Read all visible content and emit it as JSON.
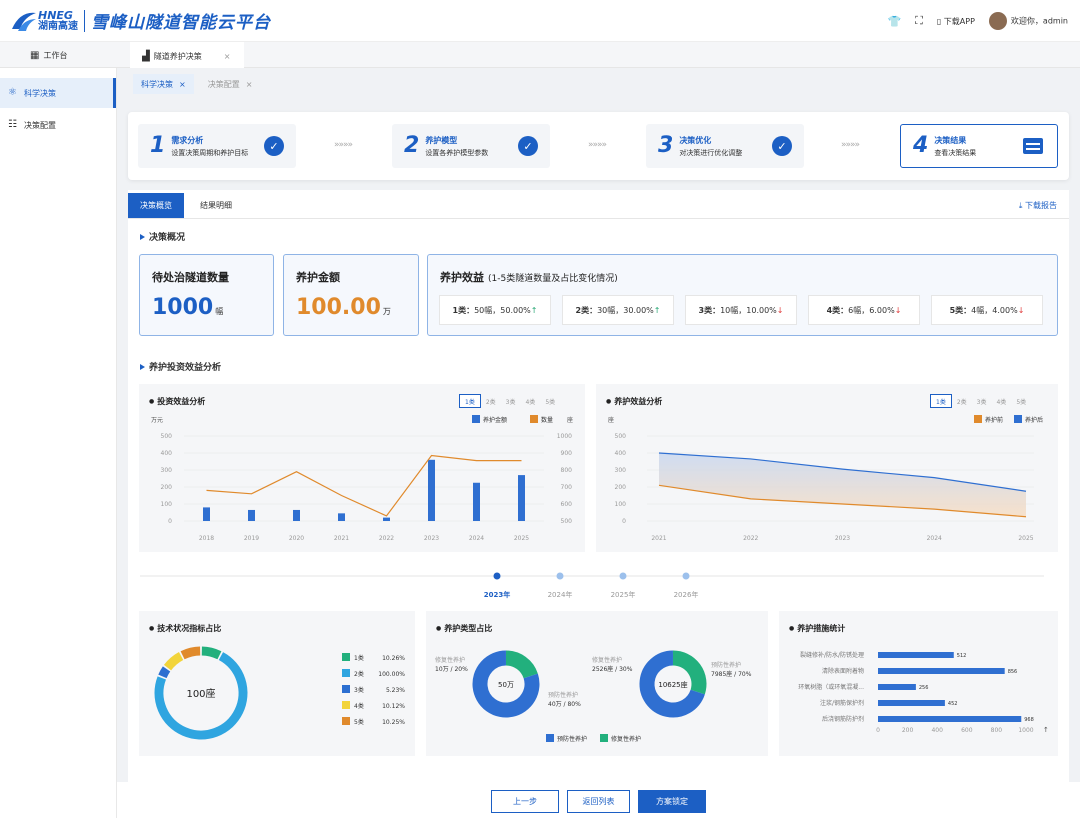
{
  "brand": {
    "en": "HNEG",
    "cn": "湖南高速",
    "title": "雪峰山隧道智能云平台"
  },
  "topbar": {
    "download_app": "下载APP",
    "welcome": "欢迎你，admin"
  },
  "tabs": {
    "workbench": "工作台",
    "active": "隧道养护决策",
    "close": "×"
  },
  "sidebar": [
    {
      "label": "科学决策"
    },
    {
      "label": "决策配置"
    }
  ],
  "subtabs": [
    {
      "label": "科学决策"
    },
    {
      "label": "决策配置"
    }
  ],
  "steps": [
    {
      "num": "1",
      "title": "需求分析",
      "sub": "设置决策周期和养护目标"
    },
    {
      "num": "2",
      "title": "养护模型",
      "sub": "设置各养护模型参数"
    },
    {
      "num": "3",
      "title": "决策优化",
      "sub": "对决策进行优化调整"
    },
    {
      "num": "4",
      "title": "决策结果",
      "sub": "查看决策结果"
    }
  ],
  "step_arrow": "»»»»",
  "content_tabs": [
    "决策概览",
    "结果明细"
  ],
  "download_report": "下载报告",
  "overview": {
    "title": "决策概况",
    "count": {
      "label": "待处治隧道数量",
      "value": "1000",
      "unit": "幅"
    },
    "amount": {
      "label": "养护金额",
      "value": "100.00",
      "unit": "万"
    },
    "benefit": {
      "label": "养护效益",
      "note": "(1-5类隧道数量及占比变化情况)",
      "items": [
        {
          "cls": "1类：",
          "text": "50幅，50.00%",
          "dir": "↑",
          "color": "#2aa876"
        },
        {
          "cls": "2类：",
          "text": "30幅，30.00%",
          "dir": "↑",
          "color": "#2aa876"
        },
        {
          "cls": "3类：",
          "text": "10幅，10.00%",
          "dir": "↓",
          "color": "#e03c3c"
        },
        {
          "cls": "4类：",
          "text": "6幅，6.00%",
          "dir": "↓",
          "color": "#e03c3c"
        },
        {
          "cls": "5类：",
          "text": "4幅，4.00%",
          "dir": "↓",
          "color": "#e03c3c"
        }
      ]
    }
  },
  "analysis_title": "养护投资效益分析",
  "class_pills": [
    "1类",
    "2类",
    "3类",
    "4类",
    "5类"
  ],
  "colors": {
    "blue": "#2f6fd1",
    "orange": "#e08a2c",
    "accent": "#1c5fc4"
  },
  "chart_data": [
    {
      "type": "bar",
      "title": "投资效益分析",
      "ylabel": "万元",
      "y2label": "座",
      "categories": [
        "2018",
        "2019",
        "2020",
        "2021",
        "2022",
        "2023",
        "2024",
        "2025"
      ],
      "series": [
        {
          "name": "养护金额",
          "type": "bar",
          "values": [
            80,
            65,
            65,
            45,
            20,
            360,
            225,
            270
          ]
        },
        {
          "name": "数量",
          "type": "line",
          "axis": "right",
          "values": [
            680,
            660,
            790,
            650,
            530,
            885,
            855,
            855
          ]
        }
      ],
      "ylim": [
        0,
        500
      ],
      "y2lim": [
        500,
        1000
      ],
      "yticks": [
        0,
        100,
        200,
        300,
        400,
        500
      ],
      "y2ticks": [
        500,
        600,
        700,
        800,
        900,
        1000
      ]
    },
    {
      "type": "area",
      "title": "养护效益分析",
      "ylabel": "座",
      "categories": [
        "2021",
        "2022",
        "2023",
        "2024",
        "2025"
      ],
      "series": [
        {
          "name": "养护前",
          "values": [
            210,
            130,
            100,
            70,
            25
          ]
        },
        {
          "name": "养护后",
          "values": [
            400,
            365,
            305,
            255,
            175
          ]
        }
      ],
      "ylim": [
        0,
        500
      ],
      "yticks": [
        0,
        100,
        200,
        300,
        400,
        500
      ]
    },
    {
      "type": "pie",
      "title": "技术状况指标占比",
      "center_label": "100座",
      "labels": [
        "1类",
        "2类",
        "3类",
        "4类",
        "5类"
      ],
      "values": [
        10.26,
        100.0,
        5.23,
        10.12,
        10.25
      ],
      "display": [
        "10.26%",
        "100.00%",
        "5.23%",
        "10.12%",
        "10.25%"
      ],
      "colors": [
        "#22b07d",
        "#2fa5e0",
        "#2c6fd1",
        "#f2d43a",
        "#e08a2c"
      ]
    },
    {
      "type": "pie",
      "title": "养护类型占比",
      "legend": [
        "预防性养护",
        "修复性养护"
      ],
      "charts": [
        {
          "center": "50万",
          "slices": [
            {
              "label": "修复性养护",
              "value": "10万 / 20%",
              "pct": 20
            },
            {
              "label": "预防性养护",
              "value": "40万 / 80%",
              "pct": 80
            }
          ]
        },
        {
          "center": "10625座",
          "slices": [
            {
              "label": "修复性养护",
              "value": "2526座 / 30%",
              "pct": 30
            },
            {
              "label": "预防性养护",
              "value": "7985座 / 70%",
              "pct": 70
            }
          ]
        }
      ]
    },
    {
      "type": "bar",
      "title": "养护措施统计",
      "orientation": "horizontal",
      "categories": [
        "裂缝修补/防水/防锈处理",
        "清除表面附着物",
        "环氧树脂（或环氧混凝...",
        "注浆/钢筋保护剂",
        "后浇钢筋防护剂"
      ],
      "values": [
        512,
        856,
        256,
        452,
        968
      ],
      "xticks": [
        0,
        200,
        400,
        600,
        800,
        1000
      ],
      "xlim": [
        0,
        1000
      ]
    }
  ],
  "timeline": [
    "2023年",
    "2024年",
    "2025年",
    "2026年"
  ],
  "buttons": {
    "prev": "上一步",
    "back": "返回列表",
    "lock": "方案锁定"
  }
}
